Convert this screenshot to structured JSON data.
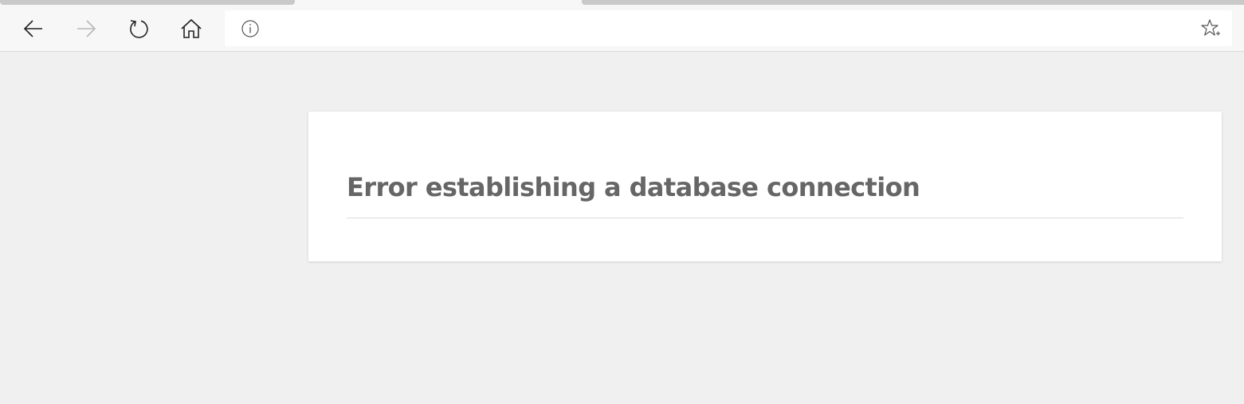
{
  "browser": {
    "address_bar": {
      "value": "",
      "placeholder": ""
    },
    "icons": {
      "back": "back-arrow-icon",
      "forward": "forward-arrow-icon",
      "refresh": "refresh-icon",
      "home": "home-icon",
      "site_info": "info-icon",
      "favorite": "add-favorite-star-icon"
    },
    "forward_enabled": false
  },
  "page": {
    "error_title": "Error establishing a database connection"
  },
  "colors": {
    "page_background": "#f0f0f0",
    "card_background": "#ffffff",
    "title_text": "#666666",
    "toolbar_background": "#f7f7f7"
  }
}
